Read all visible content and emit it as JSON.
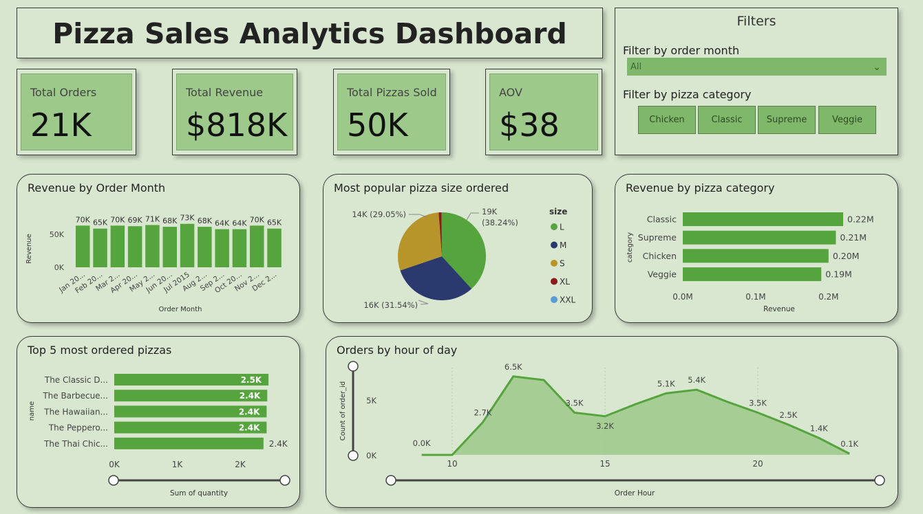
{
  "title": "Pizza Sales Analytics Dashboard",
  "filters": {
    "title": "Filters",
    "month_label": "Filter by order month",
    "month_value": "All",
    "category_label": "Filter by pizza category",
    "categories": [
      "Chicken",
      "Classic",
      "Supreme",
      "Veggie"
    ]
  },
  "kpis": [
    {
      "label": "Total Orders",
      "value": "21K"
    },
    {
      "label": "Total Revenue",
      "value": "$818K"
    },
    {
      "label": "Total Pizzas Sold",
      "value": "50K"
    },
    {
      "label": "AOV",
      "value": "$38"
    }
  ],
  "colors": {
    "green": "#56a43d",
    "navy": "#2b3a6e",
    "gold": "#b8952a",
    "maroon": "#8b1a1a",
    "blue": "#5b9bd5"
  },
  "chart_data": [
    {
      "type": "bar",
      "title": "Revenue by Order Month",
      "xlabel": "Order Month",
      "ylabel": "Revenue",
      "yticks": [
        "0K",
        "50K"
      ],
      "ylim": [
        0,
        75000
      ],
      "categories": [
        "Jan 20...",
        "Feb 20...",
        "Mar 2...",
        "Apr 20...",
        "May 2...",
        "Jun 20...",
        "Jul 2015",
        "Aug 2...",
        "Sep 2...",
        "Oct 20...",
        "Nov 2...",
        "Dec 2..."
      ],
      "values": [
        70000,
        65000,
        70000,
        69000,
        71000,
        68000,
        73000,
        68000,
        64000,
        64000,
        70000,
        65000
      ],
      "labels": [
        "70K",
        "65K",
        "70K",
        "69K",
        "71K",
        "68K",
        "73K",
        "68K",
        "64K",
        "64K",
        "70K",
        "65K"
      ]
    },
    {
      "type": "pie",
      "title": "Most popular pizza size ordered",
      "legend_title": "size",
      "slices": [
        {
          "name": "L",
          "value": 38.24,
          "color": "#56a43d"
        },
        {
          "name": "M",
          "value": 31.54,
          "color": "#2b3a6e"
        },
        {
          "name": "S",
          "value": 29.05,
          "color": "#b8952a"
        },
        {
          "name": "XL",
          "value": 1.1,
          "color": "#8b1a1a"
        },
        {
          "name": "XXL",
          "value": 0.07,
          "color": "#5b9bd5"
        }
      ],
      "labels": {
        "L": "19K\n(38.24%)",
        "M": "16K (31.54%)",
        "S": "14K (29.05%)"
      }
    },
    {
      "type": "bar",
      "orientation": "horizontal",
      "title": "Revenue by pizza category",
      "xlabel": "Revenue",
      "ylabel": "category",
      "categories": [
        "Classic",
        "Supreme",
        "Chicken",
        "Veggie"
      ],
      "values": [
        0.22,
        0.21,
        0.2,
        0.19
      ],
      "labels": [
        "0.22M",
        "0.21M",
        "0.20M",
        "0.19M"
      ],
      "xticks": [
        "0.0M",
        "0.1M",
        "0.2M"
      ],
      "xlim": [
        0,
        0.22
      ]
    },
    {
      "type": "bar",
      "orientation": "horizontal",
      "title": "Top 5 most ordered pizzas",
      "xlabel": "Sum of quantity",
      "ylabel": "name",
      "categories": [
        "The Classic D...",
        "The Barbecue...",
        "The Hawaiian...",
        "The Peppero...",
        "The Thai Chic..."
      ],
      "values": [
        2450,
        2430,
        2420,
        2420,
        2370
      ],
      "labels": [
        "2.5K",
        "2.4K",
        "2.4K",
        "2.4K",
        "2.4K"
      ],
      "xticks": [
        "0K",
        "1K",
        "2K"
      ],
      "xlim": [
        0,
        2700
      ]
    },
    {
      "type": "area",
      "title": "Orders by hour of day",
      "xlabel": "Order Hour",
      "ylabel": "Count of order_id",
      "x": [
        9,
        10,
        11,
        12,
        13,
        14,
        15,
        16,
        17,
        18,
        19,
        20,
        21,
        22,
        23
      ],
      "values": [
        0,
        0,
        2700,
        6500,
        6200,
        3500,
        3200,
        4200,
        5100,
        5400,
        4400,
        3500,
        2500,
        1400,
        100
      ],
      "point_labels": [
        "0.0K",
        "",
        "2.7K",
        "6.5K",
        "",
        "3.5K",
        "3.2K",
        "",
        "5.1K",
        "5.4K",
        "",
        "3.5K",
        "2.5K",
        "1.4K",
        "0.1K"
      ],
      "xticks": [
        "10",
        "15",
        "20"
      ],
      "yticks": [
        "0K",
        "5K"
      ],
      "ylim": [
        0,
        7000
      ]
    }
  ]
}
